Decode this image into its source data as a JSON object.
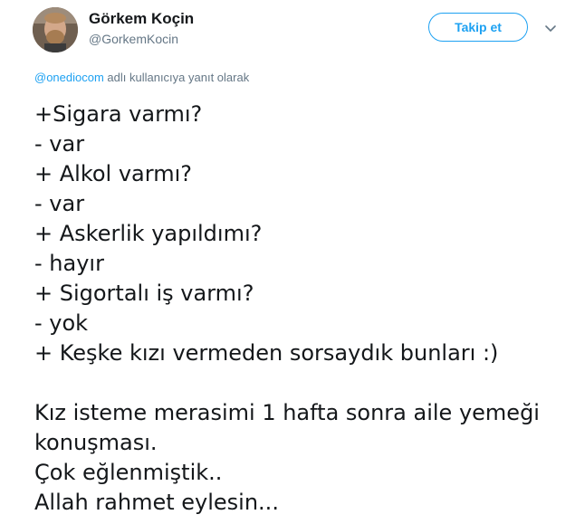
{
  "author": {
    "display_name": "Görkem Koçin",
    "handle": "@GorkemKocin"
  },
  "follow_button": {
    "label": "Takip et"
  },
  "reply_context": {
    "mention": "@onediocom",
    "suffix": " adlı kullanıcıya yanıt olarak"
  },
  "tweet": {
    "lines": [
      "+Sigara varmı?",
      "- var",
      "+ Alkol varmı?",
      "- var",
      "+ Askerlik yapıldımı?",
      "- hayır",
      "+ Sigortalı iş varmı?",
      "- yok",
      "+ Keşke kızı vermeden sorsaydık bunları :)"
    ],
    "paragraph2": [
      "Kız isteme merasimi 1 hafta sonra aile yemeği",
      "konuşması.",
      "Çok eğlenmiştik..",
      "Allah rahmet eylesin..."
    ]
  },
  "colors": {
    "accent": "#1da1f2",
    "secondary_text": "#657786",
    "primary_text": "#14171a"
  }
}
